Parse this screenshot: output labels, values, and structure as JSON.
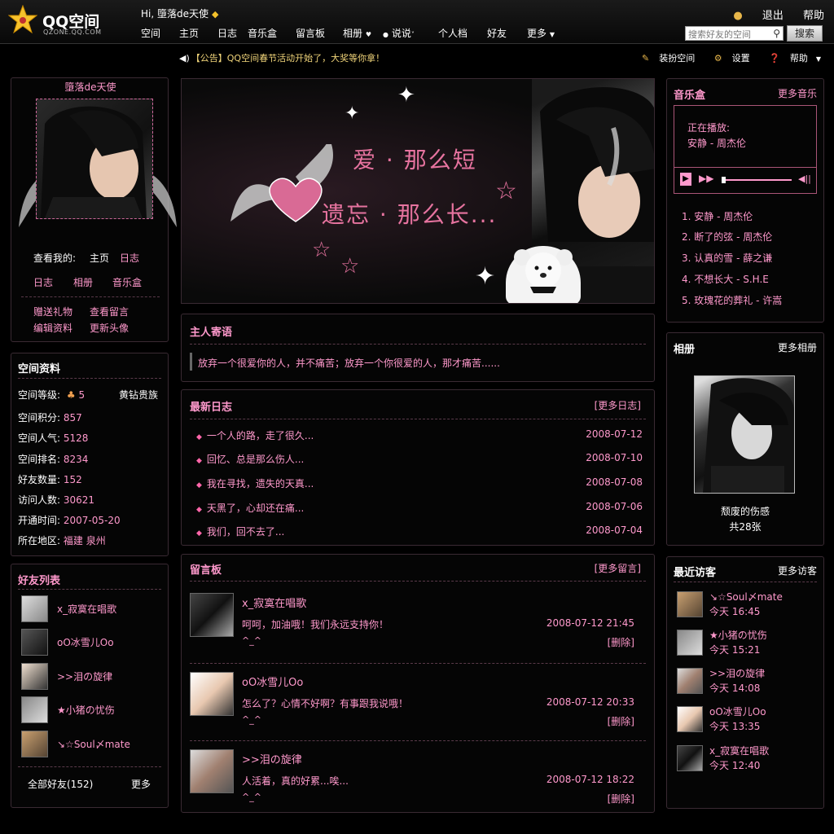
{
  "top": {
    "logo_text": "QQ空间",
    "logo_sub": "QZONE.QQ.COM",
    "greeting": "Hi, 墮落de天使",
    "logout": "退出",
    "help": "帮助",
    "search_placeholder": "搜索好友的空间",
    "search_button": "搜索"
  },
  "nav": {
    "items": [
      "空间",
      "主页",
      "日志",
      "音乐盒",
      "留言板",
      "相册",
      "说说",
      "个人档",
      "好友",
      "更多"
    ]
  },
  "notice": "【公告】QQ空间春节活动开始了，大奖等你拿！",
  "tools": {
    "dress": "装扮空间",
    "settings": "设置",
    "help": "帮助"
  },
  "profile": {
    "name": "墮落de天使",
    "visit_label": "查看我的:",
    "links": [
      "主页",
      "日志",
      "日志",
      "相册",
      "音乐盒"
    ],
    "actions": [
      "赠送礼物",
      "查看留言",
      "编辑资料",
      "更新头像"
    ]
  },
  "info": {
    "title": "空间资料",
    "rows": [
      {
        "label": "空间等级:",
        "value": "5",
        "extra": "黄钻贵族"
      },
      {
        "label": "空间积分:",
        "value": "857"
      },
      {
        "label": "空间人气:",
        "value": "5128"
      },
      {
        "label": "空间排名:",
        "value": "8234"
      },
      {
        "label": "好友数量:",
        "value": "152"
      },
      {
        "label": "访问人数:",
        "value": "30621"
      },
      {
        "label": "开通时间:",
        "value": "2007-05-20"
      },
      {
        "label": "所在地区:",
        "value": "福建 泉州"
      }
    ]
  },
  "friends": {
    "title": "好友列表",
    "items": [
      "x_寂寞在唱歌",
      "oO冰雪儿Oo",
      ">>泪の旋律",
      "★小猪の忧伤",
      "↘☆Soul〆mate"
    ],
    "all_label": "全部好友(152)",
    "more": "更多"
  },
  "banner": {
    "line1": "爱 · 那么短",
    "line2": "遗忘 · 那么长..."
  },
  "owner_msg": {
    "title": "主人寄语",
    "text": "放弃一个很爱你的人，并不痛苦；放弃一个你很爱的人，那才痛苦......"
  },
  "diary": {
    "title": "最新日志",
    "more": "[更多日志]",
    "items": [
      {
        "title": "一个人的路，走了很久...",
        "date": "2008-07-12"
      },
      {
        "title": "回忆、总是那么伤人...",
        "date": "2008-07-10"
      },
      {
        "title": "我在寻找，遗失的天真...",
        "date": "2008-07-08"
      },
      {
        "title": "天黑了，心却还在痛...",
        "date": "2008-07-06"
      },
      {
        "title": "我们，回不去了...",
        "date": "2008-07-04"
      }
    ]
  },
  "guestbook": {
    "title": "留言板",
    "more": "[更多留言]",
    "items": [
      {
        "name": "x_寂寞在唱歌",
        "text": "呵呵，加油哦！我们永远支持你！",
        "time": "2008-07-12 21:45",
        "smile": "^_^",
        "del": "[删除]"
      },
      {
        "name": "oO冰雪儿Oo",
        "text": "怎么了？心情不好啊？有事跟我说哦！",
        "time": "2008-07-12 20:33",
        "smile": "^_^",
        "del": "[删除]"
      },
      {
        "name": ">>泪の旋律",
        "text": "人活着，真的好累...唉...",
        "time": "2008-07-12 18:22",
        "smile": "^_^",
        "del": "[删除]"
      }
    ]
  },
  "music": {
    "title": "音乐盒",
    "more": "更多音乐",
    "now_label": "正在播放:",
    "now_song": "安静 - 周杰伦",
    "songs": [
      "1. 安静 - 周杰伦",
      "2. 断了的弦 - 周杰伦",
      "3. 认真的雪 - 薛之谦",
      "4. 不想长大 - S.H.E",
      "5. 玫瑰花的葬礼 - 许嵩"
    ]
  },
  "album": {
    "title": "相册",
    "more": "更多相册",
    "name": "颓废的伤感",
    "count": "共28张"
  },
  "visitors": {
    "title": "最近访客",
    "more": "更多访客",
    "items": [
      {
        "name": "↘☆Soul〆mate",
        "time": "今天 16:45"
      },
      {
        "name": "★小猪の忧伤",
        "time": "今天 15:21"
      },
      {
        "name": ">>泪の旋律",
        "time": "今天 14:08"
      },
      {
        "name": "oO冰雪儿Oo",
        "time": "今天 13:35"
      },
      {
        "name": "x_寂寞在唱歌",
        "time": "今天 12:40"
      }
    ]
  },
  "colors": {
    "accent": "#ff99cc",
    "gold": "#f1d57a",
    "background": "#000000"
  }
}
